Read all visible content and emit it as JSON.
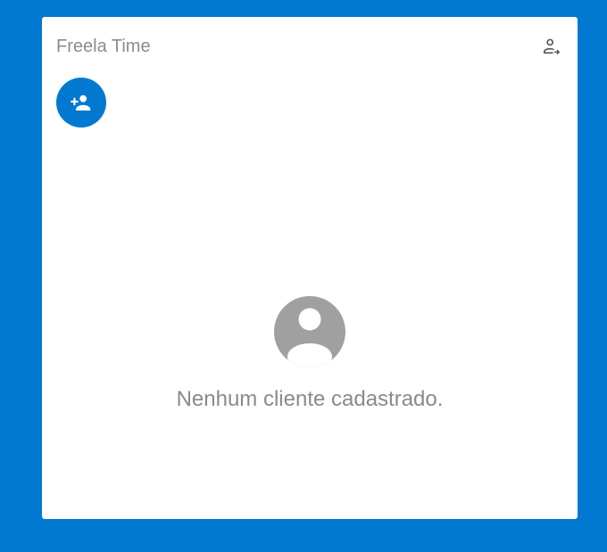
{
  "app": {
    "title": "Freela Time"
  },
  "header": {
    "logout_icon": "person-logout-icon"
  },
  "actions": {
    "add_client_icon": "person-add-icon"
  },
  "empty_state": {
    "icon": "account-circle-icon",
    "message": "Nenhum cliente cadastrado."
  },
  "colors": {
    "background": "#0279d1",
    "card": "#ffffff",
    "accent": "#0279d1",
    "muted_text": "#8c8c8c",
    "empty_icon": "#a0a0a0"
  }
}
